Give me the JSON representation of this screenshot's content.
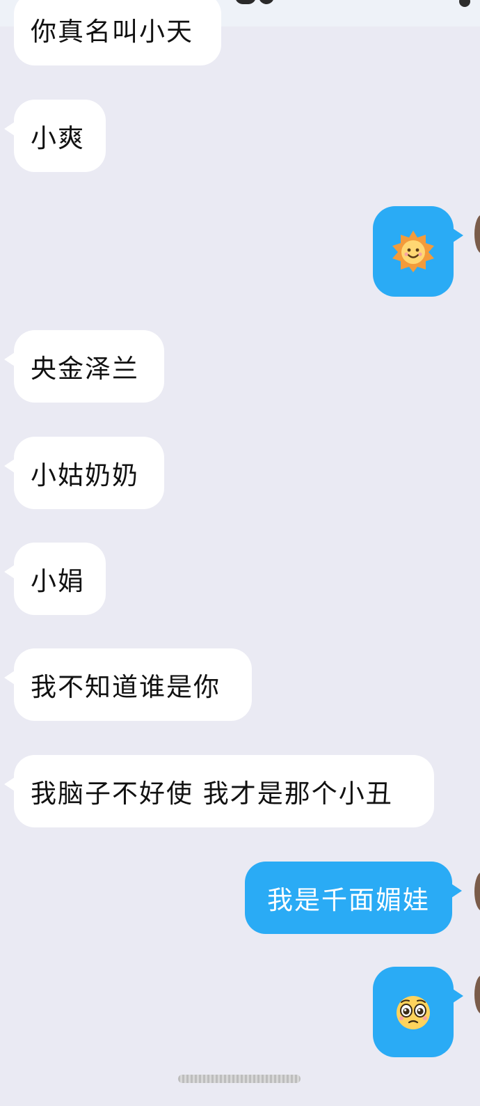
{
  "messages": [
    {
      "side": "in",
      "text": "你真名叫小天",
      "partial": true
    },
    {
      "side": "in",
      "text": "小爽"
    },
    {
      "side": "out",
      "emoji": "sun-smile-emoji"
    },
    {
      "side": "in",
      "text": "央金泽兰"
    },
    {
      "side": "in",
      "text": "小姑奶奶"
    },
    {
      "side": "in",
      "text": "小娟"
    },
    {
      "side": "in",
      "text": "我不知道谁是你"
    },
    {
      "side": "in",
      "text": "我脑子不好使 我才是那个小丑"
    },
    {
      "side": "out",
      "text": "我是千面媚娃"
    },
    {
      "side": "out",
      "emoji": "pleading-face-emoji"
    }
  ],
  "colors": {
    "background": "#eaeaf3",
    "incoming_bubble": "#ffffff",
    "outgoing_bubble": "#2aabf5",
    "incoming_text": "#111111",
    "outgoing_text": "#ffffff"
  }
}
